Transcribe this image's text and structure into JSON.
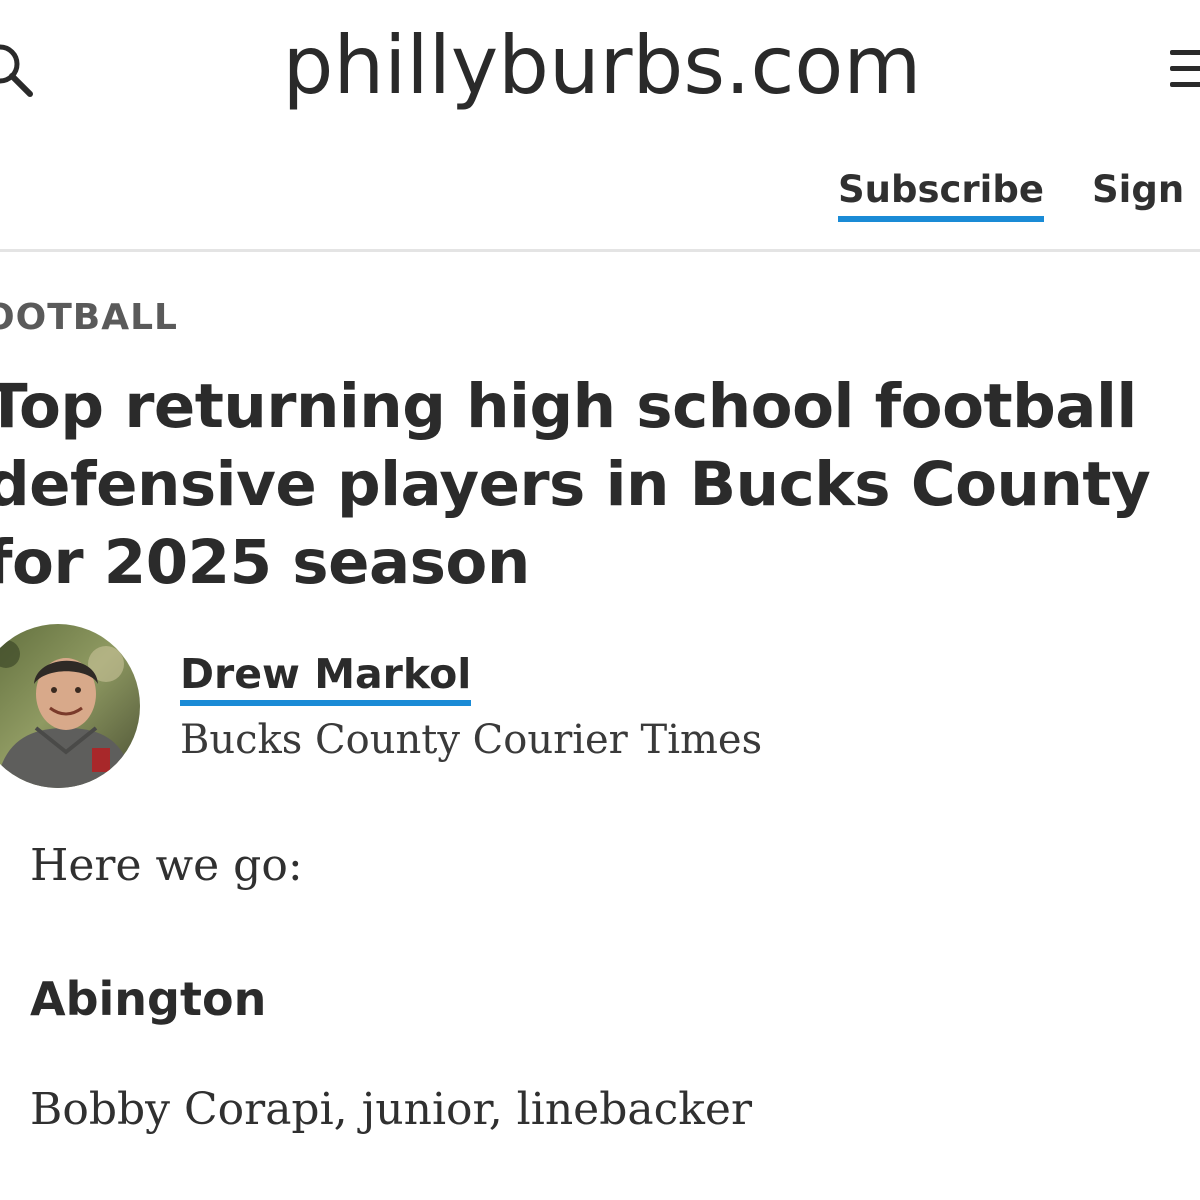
{
  "header": {
    "site_title": "phillyburbs.com",
    "search_icon": "search-icon",
    "menu_icon": "hamburger-menu-icon"
  },
  "account": {
    "subscribe_label": "Subscribe",
    "signin_label": "Sign I"
  },
  "article": {
    "section_label": "OOTBALL",
    "headline_lines": [
      "Top returning high school football",
      "defensive players in Bucks County",
      "for 2025 season"
    ],
    "author": {
      "name": "Drew Markol",
      "publication": "Bucks County Courier Times"
    },
    "intro": "Here we go:",
    "team_heading": "Abington",
    "player_line": "Bobby Corapi, junior, linebacker"
  },
  "colors": {
    "accent": "#1a8bd6",
    "text": "#2b2b2b",
    "divider": "#e4e4e4"
  }
}
